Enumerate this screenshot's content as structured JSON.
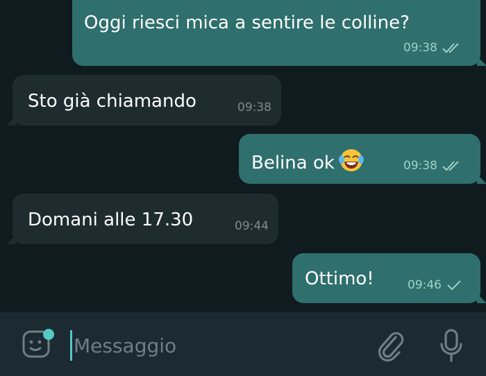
{
  "messages": [
    {
      "direction": "outgoing",
      "text": "Oggi riesci mica a sentire le colline?",
      "time": "09:38",
      "status": "read"
    },
    {
      "direction": "incoming",
      "text": "Sto già chiamando",
      "time": "09:38"
    },
    {
      "direction": "outgoing",
      "text": "Belina ok",
      "emoji": "face-with-tears-of-joy",
      "time": "09:38",
      "status": "read"
    },
    {
      "direction": "incoming",
      "text": "Domani alle 17.30",
      "time": "09:44"
    },
    {
      "direction": "outgoing",
      "text": "Ottimo!",
      "time": "09:46",
      "status": "sent"
    }
  ],
  "composer": {
    "placeholder": "Messaggio",
    "left_icon": "sticker-icon",
    "attach_icon": "paperclip-icon",
    "mic_icon": "microphone-icon"
  },
  "colors": {
    "chat_background": "#0f1b1e",
    "outgoing_bubble": "#2f6f6d",
    "incoming_bubble": "#1e2c30",
    "accent": "#55c8c0",
    "composer_background": "#1c2a31"
  }
}
